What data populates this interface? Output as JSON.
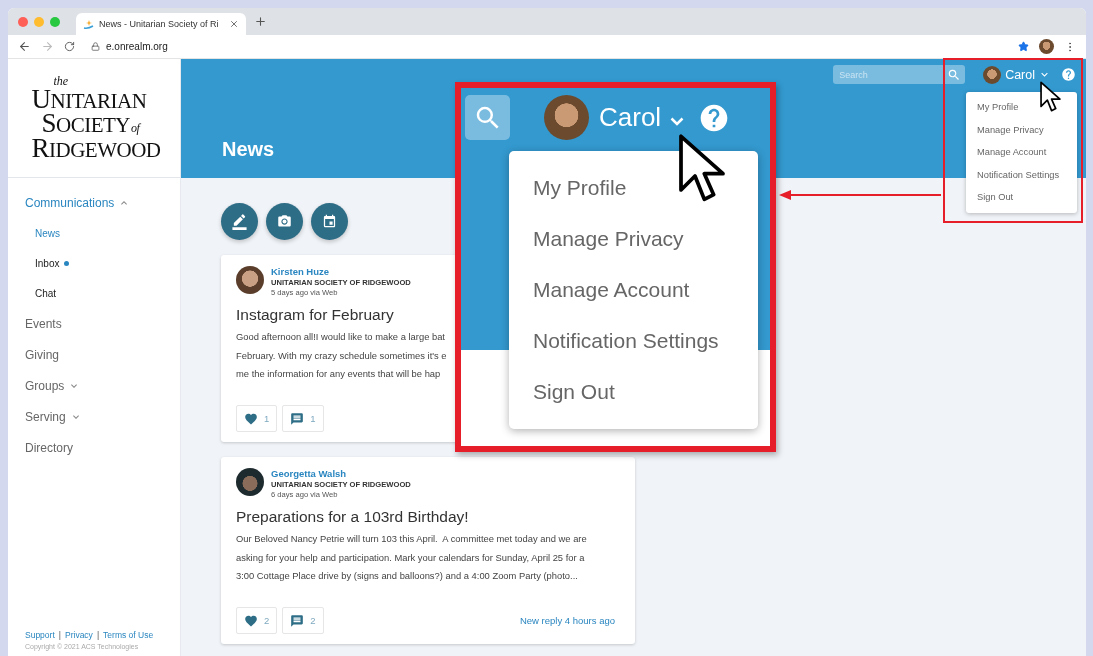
{
  "browser": {
    "tab_title": "News - Unitarian Society of Ri",
    "url": "e.onrealm.org"
  },
  "logo": {
    "small_top": "the",
    "lines": [
      {
        "text": "UNITARIAN"
      },
      {
        "text": "SOCIETY",
        "suffix": "of"
      },
      {
        "text": "RIDGEWOOD"
      }
    ]
  },
  "sidebar": {
    "items": [
      {
        "kind": "group",
        "label": "Communications",
        "expanded": true,
        "children": [
          {
            "label": "News",
            "selected": true,
            "unread": false
          },
          {
            "label": "Inbox",
            "selected": false,
            "unread": true
          },
          {
            "label": "Chat",
            "selected": false,
            "unread": false
          }
        ]
      },
      {
        "kind": "link",
        "label": "Events"
      },
      {
        "kind": "link",
        "label": "Giving"
      },
      {
        "kind": "group",
        "label": "Groups",
        "expanded": false
      },
      {
        "kind": "group",
        "label": "Serving",
        "expanded": false
      },
      {
        "kind": "link",
        "label": "Directory"
      }
    ],
    "footer": [
      {
        "kind": "link",
        "text": "Support"
      },
      {
        "kind": "separator",
        "text": "|"
      },
      {
        "kind": "link",
        "text": "Privacy"
      },
      {
        "kind": "separator",
        "text": "|"
      },
      {
        "kind": "link",
        "text": "Terms of Use"
      }
    ],
    "copyright": "Copyright © 2021 ACS Technologies"
  },
  "header": {
    "page_title": "News",
    "search": {
      "placeholder": "Search"
    },
    "user": {
      "name": "Carol"
    },
    "user_menu": {
      "open": true,
      "items": [
        "My Profile",
        "Manage Privacy",
        "Manage Account",
        "Notification Settings",
        "Sign Out"
      ]
    }
  },
  "posts": [
    {
      "author": "Kirsten Huze",
      "organization": "UNITARIAN SOCIETY OF RIDGEWOOD",
      "meta": "5 days ago via Web",
      "title": "Instagram for February",
      "body_lines": [
        "Good afternoon all!I would like to make a large bat",
        "February. With my crazy schedule sometimes it's e",
        "me the information for any events that will be hap"
      ],
      "likes": "1",
      "comments": "1"
    },
    {
      "author": "Georgetta Walsh",
      "organization": "UNITARIAN SOCIETY OF RIDGEWOOD",
      "meta": "6 days ago via Web",
      "title": "Preparations for a 103rd Birthday!",
      "body_lines": [
        "Our Beloved Nancy Petrie will turn 103 this April.  A committee met today and we are",
        "asking for your help and participation. Mark your calendars for Sunday, April 25 for a",
        "3:00 Cottage Place drive by (signs and balloons?) and a 4:00 Zoom Party (photo..."
      ],
      "likes": "2",
      "comments": "2",
      "reply_note": "New reply 4 hours ago"
    }
  ],
  "callout": {
    "user": {
      "name": "Carol"
    },
    "menu_items": [
      "My Profile",
      "Manage Privacy",
      "Manage Account",
      "Notification Settings",
      "Sign Out"
    ]
  }
}
